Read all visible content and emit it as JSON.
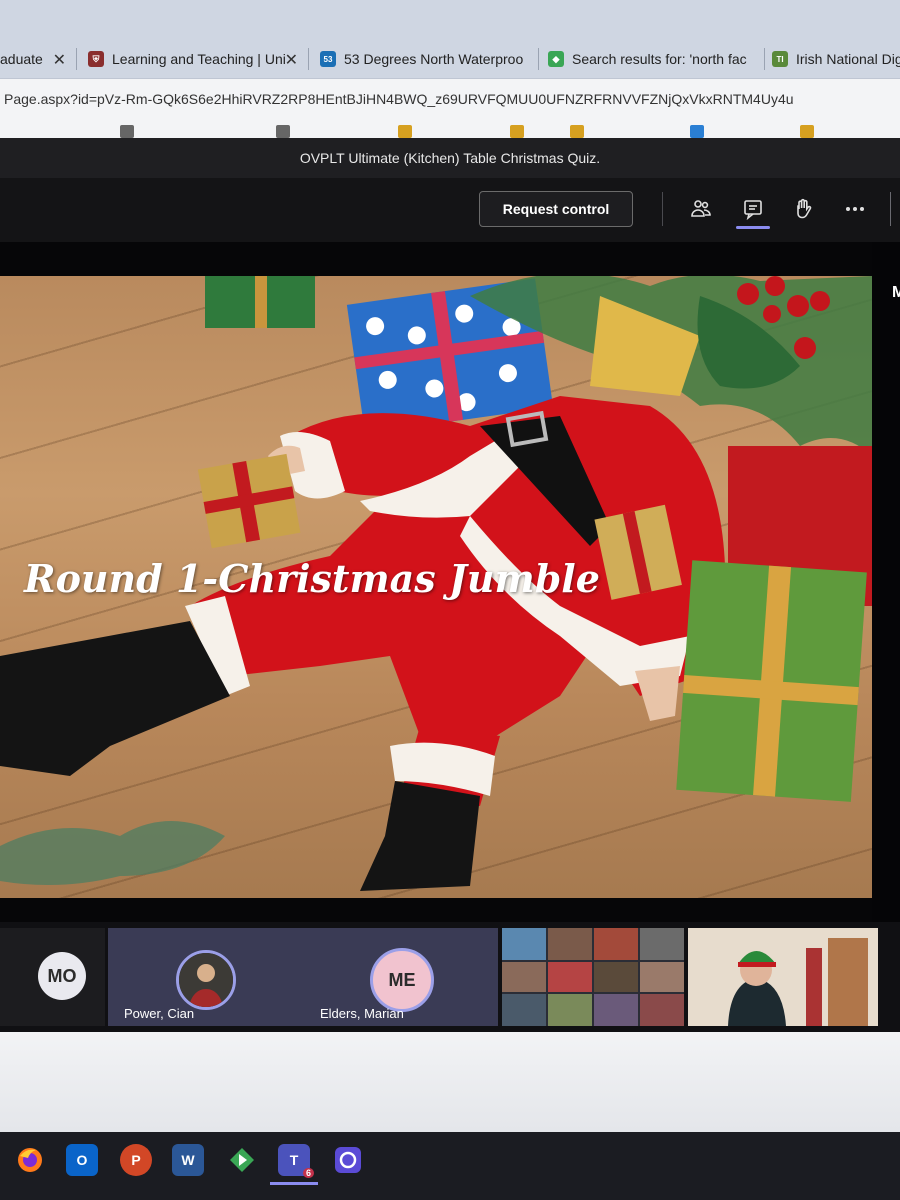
{
  "browser": {
    "tabs": [
      {
        "label": "aduate",
        "favicon_color": "#2b5797"
      },
      {
        "label": "Learning and Teaching | Uni",
        "favicon_color": "#8a2e2e"
      },
      {
        "label": "53 Degrees North Waterproo",
        "favicon_color": "#1b6fb5",
        "favicon_text": "53"
      },
      {
        "label": "Search results for: 'north fac",
        "favicon_color": "#3aa655"
      },
      {
        "label": "Irish National Digita",
        "favicon_color": "#5a8a3a",
        "favicon_text": "TI"
      }
    ],
    "address": "Page.aspx?id=pVz-Rm-GQk6S6e2HhiRVRZ2RP8HEntBJiHN4BWQ_z69URVFQMUU0UFNZRFRNVVFZNjQxVkxRNTM4Uy4u"
  },
  "meeting": {
    "title": "OVPLT Ultimate (Kitchen) Table Christmas Quiz.",
    "request_control": "Request control",
    "toolbar_icons": [
      "participants-icon",
      "chat-icon",
      "raise-hand-icon",
      "more-icon"
    ]
  },
  "slide": {
    "caption": "Round 1-Christmas Jumble"
  },
  "side_panel": {
    "letter": "M"
  },
  "participants": [
    {
      "initials": "MO",
      "name": ""
    },
    {
      "initials": "",
      "name": "Power, Cian"
    },
    {
      "initials": "ME",
      "name": "Elders, Marian"
    }
  ],
  "taskbar": [
    "firefox-icon",
    "outlook-icon",
    "powerpoint-icon",
    "word-icon",
    "app-icon",
    "teams-icon",
    "cortana-icon"
  ],
  "taskbar_badges": {
    "teams": "6"
  },
  "colors": {
    "teams_accent": "#8b8cf0",
    "santa_red": "#d2121a"
  }
}
